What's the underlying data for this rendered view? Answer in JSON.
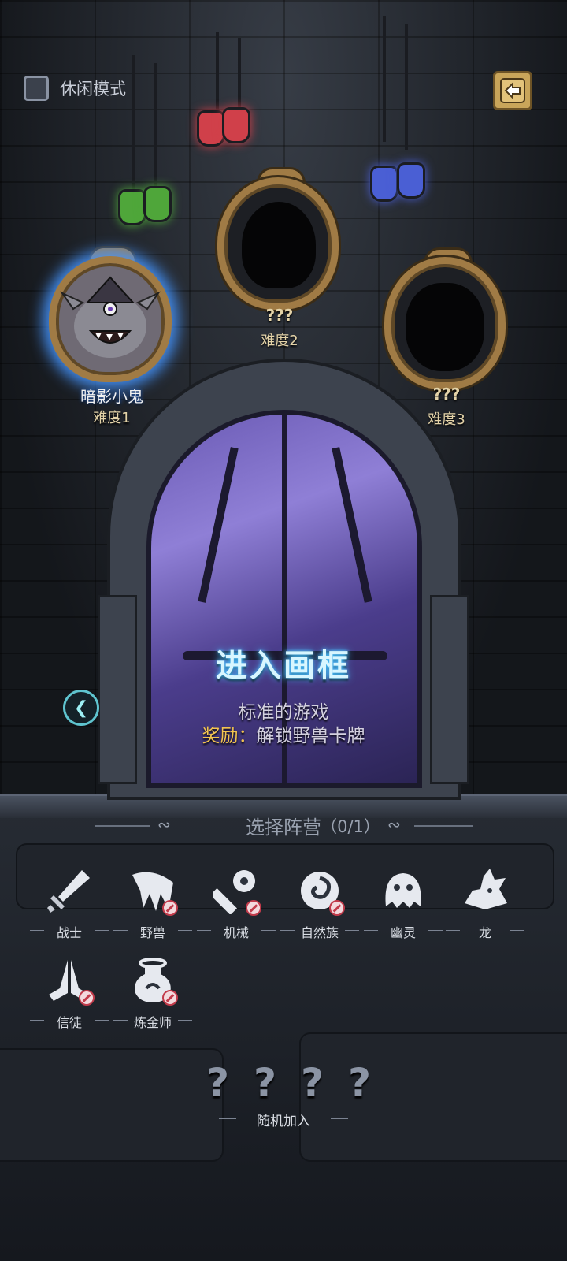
{
  "top": {
    "casual_mode_label": "休闲模式",
    "casual_mode_checked": false
  },
  "characters": [
    {
      "name": "暗影小鬼",
      "difficulty": "难度1",
      "unlocked": true
    },
    {
      "name": "???",
      "difficulty": "难度2",
      "unlocked": false
    },
    {
      "name": "???",
      "difficulty": "难度3",
      "unlocked": false
    }
  ],
  "potions": [
    {
      "color": "#4fa63a",
      "icon": "green-potion"
    },
    {
      "color": "#d0404a",
      "icon": "red-potion"
    },
    {
      "color": "#4a5fd4",
      "icon": "blue-potion"
    }
  ],
  "gate": {
    "title": "进入画框",
    "description": "标准的游戏",
    "reward_prefix": "奖励：",
    "reward_text": "解锁野兽卡牌"
  },
  "faction_select": {
    "title": "选择阵营",
    "count": "（0/1）",
    "factions": [
      {
        "label": "战士",
        "icon": "sword-icon",
        "locked": false
      },
      {
        "label": "野兽",
        "icon": "beast-claw-icon",
        "locked": true
      },
      {
        "label": "机械",
        "icon": "wrench-icon",
        "locked": true
      },
      {
        "label": "自然族",
        "icon": "nature-swirl-icon",
        "locked": true
      },
      {
        "label": "幽灵",
        "icon": "ghost-icon",
        "locked": false
      },
      {
        "label": "龙",
        "icon": "dragon-icon",
        "locked": false
      },
      {
        "label": "信徒",
        "icon": "praying-hands-icon",
        "locked": true
      },
      {
        "label": "炼金师",
        "icon": "flask-icon",
        "locked": true
      }
    ]
  },
  "random": {
    "marks": [
      "?",
      "?",
      "?",
      "?"
    ],
    "label": "随机加入"
  }
}
